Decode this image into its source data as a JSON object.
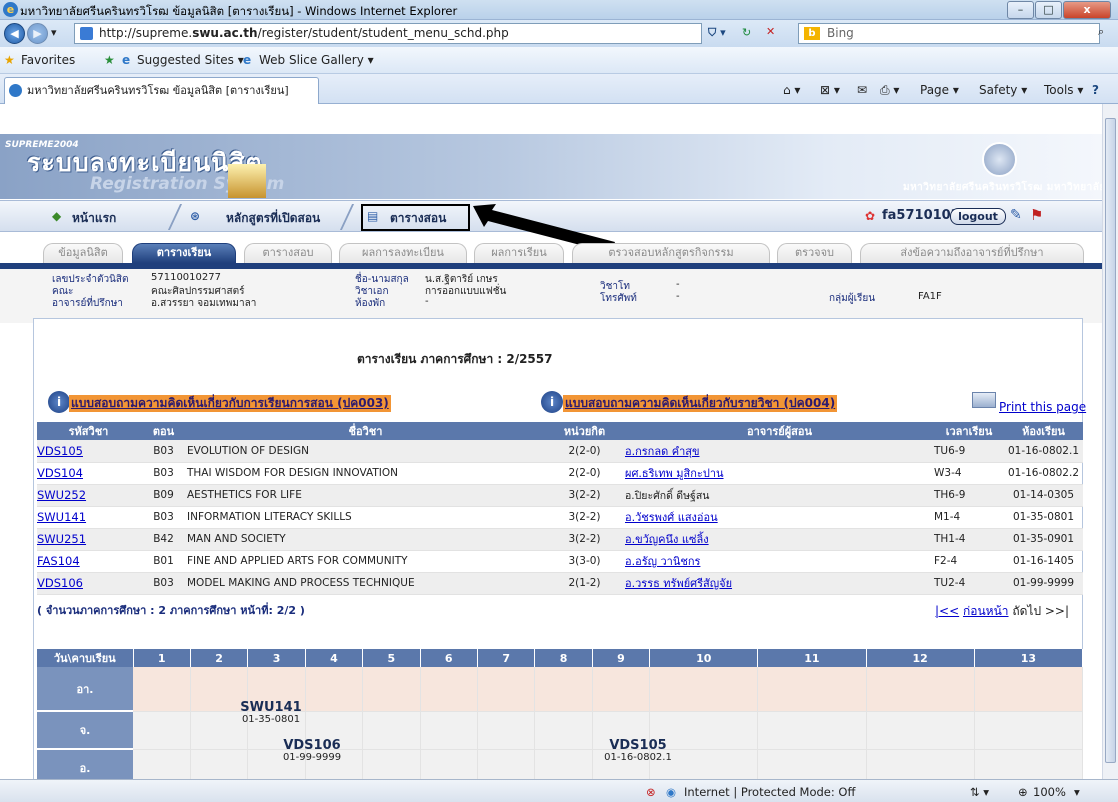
{
  "window": {
    "title": "มหาวิทยาลัยศรีนครินทรวิโรฒ ข้อมูลนิสิต [ตารางเรียน] - Windows Internet Explorer",
    "minimize": "–",
    "maximize": "□",
    "close": "x"
  },
  "address": {
    "url_pre": "http://supreme.",
    "url_host": "swu.ac.th",
    "url_post": "/register/student/student_menu_schd.php",
    "search_placeholder": "Bing"
  },
  "favorites": {
    "favorites_label": "Favorites",
    "suggested_sites": "Suggested Sites ▾",
    "web_slice_gallery": "Web Slice Gallery ▾"
  },
  "tab": {
    "label": "มหาวิทยาลัยศรีนครินทรวิโรฒ ข้อมูลนิสิต [ตารางเรียน]"
  },
  "commandbar": {
    "page": "Page ▾",
    "safety": "Safety ▾",
    "tools": "Tools ▾"
  },
  "banner": {
    "small": "SUPREME2004",
    "title": "ระบบลงทะเบียนนิสิต",
    "subtitle": "Registration System",
    "university": "มหาวิทยาลัยศรีนครินทรวิโรฒ มหาวิทยาลัย"
  },
  "topnav": {
    "home": "หน้าแรก",
    "courses": "หลักสูตรที่เปิดสอน",
    "exam": "ตารางสอน",
    "username": "fa571010277",
    "logout": "logout"
  },
  "subtabs": [
    "ข้อมูลนิสิต",
    "ตารางเรียน",
    "ตารางสอบ",
    "ผลการลงทะเบียน",
    "ผลการเรียน",
    "ตรวจสอบหลักสูตรกิจกรรม",
    "ตรวจจบ",
    "ส่งข้อความถึงอาจารย์ที่ปรึกษา"
  ],
  "student": {
    "id_label": "เลขประจำตัวนิสิต",
    "id_value": "57110010277",
    "faculty_label": "คณะ",
    "faculty_value": "คณะศิลปกรรมศาสตร์",
    "advisor_label": "อาจารย์ที่ปรึกษา",
    "advisor_value": "อ.สวรรยา จอมเทพมาลา",
    "name_label": "ชื่อ-นามสกุล",
    "name_value": "น.ส.ฐิตาริย์ เกษร",
    "major_label": "วิชาเอก",
    "major_value": "การออกแบบแฟชั่น",
    "room_label": "ห้องพัก",
    "room_value": "-",
    "minor_label": "วิชาโท",
    "minor_value": "-",
    "phone_label": "โทรศัพท์",
    "phone_value": "-",
    "group_label": "กลุ่มผู้เรียน",
    "group_value": "FA1F"
  },
  "schedule": {
    "title": "ตารางเรียน ภาคการศึกษา :  2/2557",
    "eval1": "แบบสอบถามความคิดเห็นเกี่ยวกับการเรียนการสอน (ปค003)",
    "eval2": "แบบสอบถามความคิดเห็นเกี่ยวกับรายวิชา (ปค004)",
    "print": "Print this page",
    "headers": [
      "รหัสวิชา",
      "ตอน",
      "ชื่อวิชา",
      "หน่วยกิต",
      "อาจารย์ผู้สอน",
      "เวลาเรียน",
      "ห้องเรียน"
    ],
    "rows": [
      [
        "VDS105",
        "B03",
        "EVOLUTION OF DESIGN",
        "2(2-0)",
        "อ.กรกลด คำสุข",
        "TU6-9",
        "01-16-0802.1"
      ],
      [
        "VDS104",
        "B03",
        "THAI WISDOM FOR DESIGN INNOVATION",
        "2(2-0)",
        "ผศ.ธริเทพ มูสิกะปาน",
        "W3-4",
        "01-16-0802.2"
      ],
      [
        "SWU252",
        "B09",
        "AESTHETICS FOR LIFE",
        "3(2-2)",
        "อ.ปิยะศักดิ์ ดีษฐ์สน",
        "TH6-9",
        "01-14-0305"
      ],
      [
        "SWU141",
        "B03",
        "INFORMATION LITERACY SKILLS",
        "3(2-2)",
        "อ.วัชรพงศ์ แสงอ่อน",
        "M1-4",
        "01-35-0801"
      ],
      [
        "SWU251",
        "B42",
        "MAN AND SOCIETY",
        "3(2-2)",
        "อ.ขวัญคนึง แซ่ลิ้ง",
        "TH1-4",
        "01-35-0901"
      ],
      [
        "FAS104",
        "B01",
        "FINE AND APPLIED ARTS FOR COMMUNITY",
        "3(3-0)",
        "อ.อรัญ วานิชกร",
        "F2-4",
        "01-16-1405"
      ],
      [
        "VDS106",
        "B03",
        "MODEL MAKING AND PROCESS TECHNIQUE",
        "2(1-2)",
        "อ.วรรธ ทรัพย์ศรีสัญจัย",
        "TU2-4",
        "01-99-9999"
      ]
    ],
    "paging": "( จำนวนภาคการศึกษา : 2 ภาคการศึกษา  หน้าที่: 2/2 )",
    "pager_first": "|<<",
    "pager_prev": "ก่อนหน้า",
    "pager_next": "ถัดไป >>|"
  },
  "grid": {
    "corner": "วัน\\คาบเรียน",
    "periods": [
      "1",
      "2",
      "3",
      "4",
      "5",
      "6",
      "7",
      "8",
      "9",
      "10",
      "11",
      "12",
      "13"
    ],
    "days": [
      "อา.",
      "จ.",
      "อ."
    ],
    "slot_swu141_code": "SWU141",
    "slot_swu141_room": "01-35-0801",
    "slot_vds106_code": "VDS106",
    "slot_vds106_room": "01-99-9999",
    "slot_vds105_code": "VDS105",
    "slot_vds105_room": "01-16-0802.1"
  },
  "status": {
    "zone": "Internet | Protected Mode: Off",
    "zoom": "100%"
  },
  "colors": {
    "nav_blue": "#1f3f7c",
    "header_blue": "#5b78ab",
    "eval_orange": "#f29535",
    "link": "#0000cc"
  }
}
